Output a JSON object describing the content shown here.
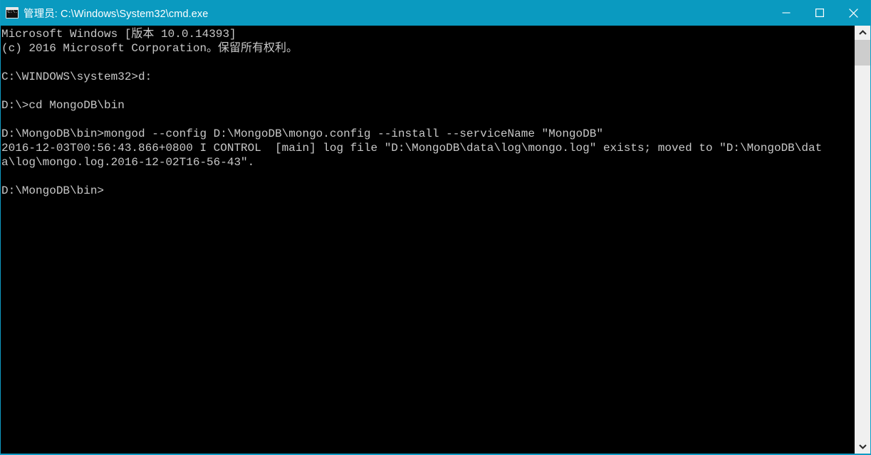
{
  "window": {
    "title": "管理员: C:\\Windows\\System32\\cmd.exe",
    "icon": "cmd-console-icon",
    "titlebar_color": "#0a9ac0",
    "background_color": "#000000",
    "text_color": "#c8c8c8",
    "controls": {
      "minimize_label": "最小化",
      "maximize_label": "最大化",
      "close_label": "关闭"
    }
  },
  "console": {
    "lines": [
      "Microsoft Windows [版本 10.0.14393]",
      "(c) 2016 Microsoft Corporation。保留所有权利。",
      "",
      "C:\\WINDOWS\\system32>d:",
      "",
      "D:\\>cd MongoDB\\bin",
      "",
      "D:\\MongoDB\\bin>mongod --config D:\\MongoDB\\mongo.config --install --serviceName ″MongoDB″",
      "2016-12-03T00:56:43.866+0800 I CONTROL  [main] log file ″D:\\MongoDB\\data\\log\\mongo.log″ exists; moved to ″D:\\MongoDB\\dat",
      "a\\log\\mongo.log.2016-12-02T16-56-43″.",
      "",
      "D:\\MongoDB\\bin>"
    ],
    "full_text": "Microsoft Windows [版本 10.0.14393]\n(c) 2016 Microsoft Corporation。保留所有权利。\n\nC:\\WINDOWS\\system32>d:\n\nD:\\>cd MongoDB\\bin\n\nD:\\MongoDB\\bin>mongod --config D:\\MongoDB\\mongo.config --install --serviceName ″MongoDB″\n2016-12-03T00:56:43.866+0800 I CONTROL  [main] log file ″D:\\MongoDB\\data\\log\\mongo.log″ exists; moved to ″D:\\MongoDB\\dat\na\\log\\mongo.log.2016-12-02T16-56-43″.\n\nD:\\MongoDB\\bin>"
  },
  "scrollbar": {
    "up_icon": "chevron-up-icon",
    "down_icon": "chevron-down-icon",
    "thumb_position_percent": 0,
    "track_color": "#f0f0f0",
    "thumb_color": "#cdcdcd"
  }
}
